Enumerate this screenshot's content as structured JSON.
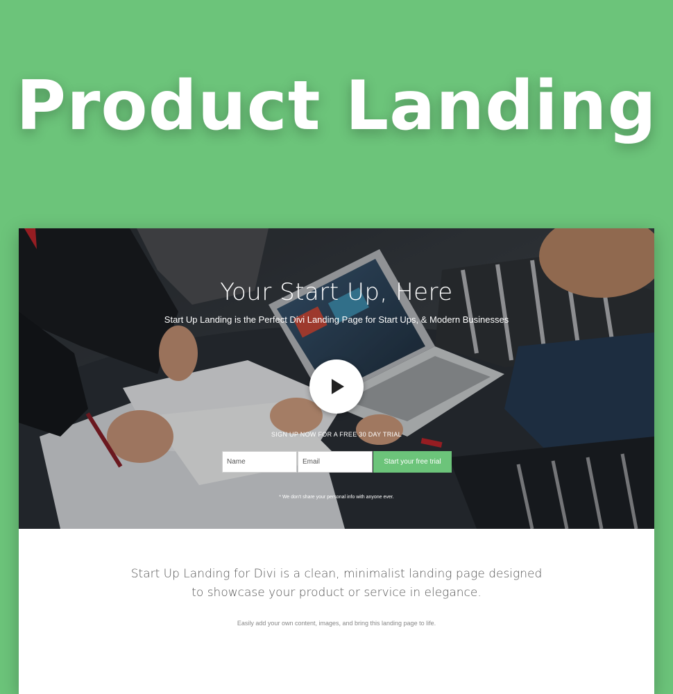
{
  "banner": {
    "title": "Product Landing"
  },
  "hero": {
    "title": "Your Start Up, Here",
    "subtitle": "Start Up Landing is the Perfect Divi Landing Page for Start Ups, & Modern Businesses",
    "play_icon": "play-icon",
    "signup_caption": "SIGN UP NOW FOR A FREE 30 DAY TRIAL",
    "form": {
      "name_placeholder": "Name",
      "email_placeholder": "Email",
      "submit_label": "Start your free trial"
    },
    "privacy_note": "* We don't share your personal info with anyone ever."
  },
  "content": {
    "intro": "Start Up Landing for Divi is a clean, minimalist landing page designed to showcase your product or service in elegance.",
    "sub": "Easily add your own content, images, and bring this landing page to life."
  },
  "colors": {
    "brand_green": "#6cc47a",
    "white": "#ffffff",
    "text_dark": "#555555",
    "text_muted": "#888888"
  }
}
